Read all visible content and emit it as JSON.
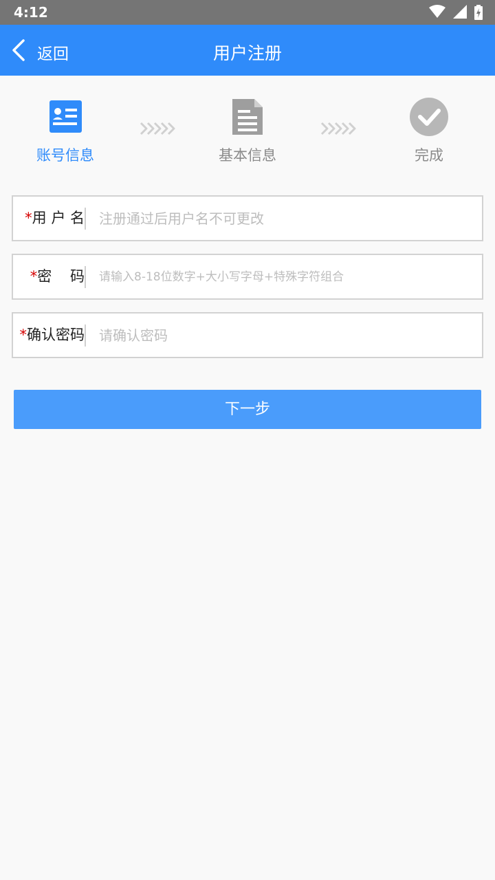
{
  "status_bar": {
    "time": "4:12",
    "icons": [
      "wifi-icon",
      "signal-icon",
      "battery-icon"
    ]
  },
  "app_bar": {
    "back_label": "返回",
    "title": "用户注册"
  },
  "steps": [
    {
      "label": "账号信息",
      "icon": "id-card-icon",
      "state": "active"
    },
    {
      "label": "基本信息",
      "icon": "document-icon",
      "state": "pending"
    },
    {
      "label": "完成",
      "icon": "check-circle-icon",
      "state": "pending"
    }
  ],
  "form": {
    "required_mark": "*",
    "fields": [
      {
        "label": "用 户 名",
        "value": "",
        "placeholder": "注册通过后用户名不可更改"
      },
      {
        "label": "密    码",
        "value": "",
        "placeholder": "请输入8-18位数字+大小写字母+特殊字符组合"
      },
      {
        "label": "确认密码",
        "value": "",
        "placeholder": "请确认密码"
      }
    ]
  },
  "next_button": {
    "label": "下一步"
  },
  "colors": {
    "primary": "#2f8bfa",
    "button": "#4a9cfb",
    "required": "#d50000",
    "inactive": "#9e9e9e"
  }
}
